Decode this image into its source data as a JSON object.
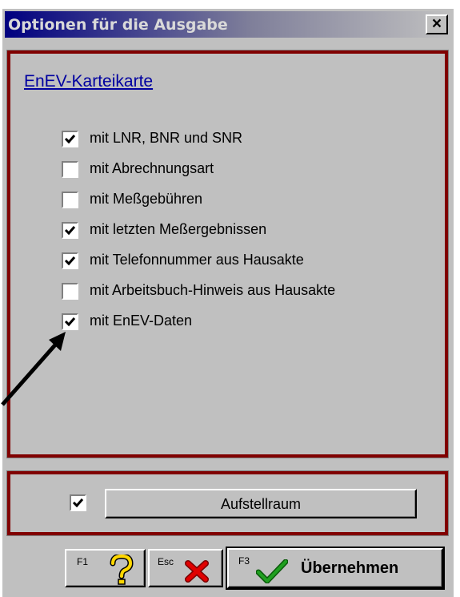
{
  "window": {
    "title": "Optionen für die Ausgabe",
    "close_glyph": "×"
  },
  "main_group": {
    "link": "EnEV-Karteikarte",
    "options": [
      {
        "label": "mit LNR, BNR und SNR",
        "checked": true
      },
      {
        "label": "mit Abrechnungsart",
        "checked": false
      },
      {
        "label": "mit Meßgebühren",
        "checked": false
      },
      {
        "label": "mit letzten Meßergebnissen",
        "checked": true
      },
      {
        "label": "mit Telefonnummer aus Hausakte",
        "checked": true
      },
      {
        "label": "mit Arbeitsbuch-Hinweis aus Hausakte",
        "checked": false
      },
      {
        "label": "mit EnEV-Daten",
        "checked": true
      }
    ]
  },
  "room_group": {
    "checked": true,
    "button_label": "Aufstellraum"
  },
  "footer": {
    "help": {
      "key": "F1",
      "icon": "question-mark-icon",
      "icon_color": "#ffd700"
    },
    "cancel": {
      "key": "Esc",
      "icon": "red-x-icon",
      "icon_color": "#e00000"
    },
    "ok": {
      "key": "F3",
      "icon": "green-checkmark-icon",
      "icon_color": "#20a020",
      "label": "Übernehmen"
    }
  },
  "annotation": {
    "icon": "arrow-icon",
    "color": "#000000"
  }
}
